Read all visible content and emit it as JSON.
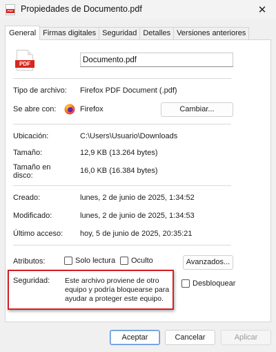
{
  "window": {
    "title": "Propiedades de Documento.pdf",
    "close_icon": "close-icon",
    "pdf_icon_label": "PDF"
  },
  "tabs": [
    {
      "label": "General"
    },
    {
      "label": "Firmas digitales"
    },
    {
      "label": "Seguridad"
    },
    {
      "label": "Detalles"
    },
    {
      "label": "Versiones anteriores"
    }
  ],
  "file": {
    "icon_label": "PDF",
    "name": "Documento.pdf"
  },
  "type": {
    "label": "Tipo de archivo:",
    "value": "Firefox PDF Document (.pdf)"
  },
  "opens_with": {
    "label": "Se abre con:",
    "value": "Firefox",
    "change_button": "Cambiar..."
  },
  "location": {
    "label": "Ubicación:",
    "value": "C:\\Users\\Usuario\\Downloads"
  },
  "size": {
    "label": "Tamaño:",
    "value": "12,9 KB (13.264 bytes)"
  },
  "size_on_disk": {
    "label_line1": "Tamaño en",
    "label_line2": "disco:",
    "value": "16,0 KB (16.384 bytes)"
  },
  "created": {
    "label": "Creado:",
    "value": "lunes, 2 de junio de 2025, 1:34:52"
  },
  "modified": {
    "label": "Modificado:",
    "value": "lunes, 2 de junio de 2025, 1:34:53"
  },
  "accessed": {
    "label": "Último acceso:",
    "value": "hoy, 5 de junio de 2025, 20:35:21"
  },
  "attributes": {
    "label": "Atributos:",
    "readonly": "Solo lectura",
    "hidden": "Oculto",
    "advanced_button": "Avanzados..."
  },
  "security": {
    "label": "Seguridad:",
    "line1": "Este archivo proviene de otro",
    "line2": "equipo y podría bloquearse para",
    "line3": "ayudar a proteger este equipo.",
    "unblock": "Desbloquear"
  },
  "footer": {
    "accept": "Aceptar",
    "cancel": "Cancelar",
    "apply": "Aplicar"
  }
}
